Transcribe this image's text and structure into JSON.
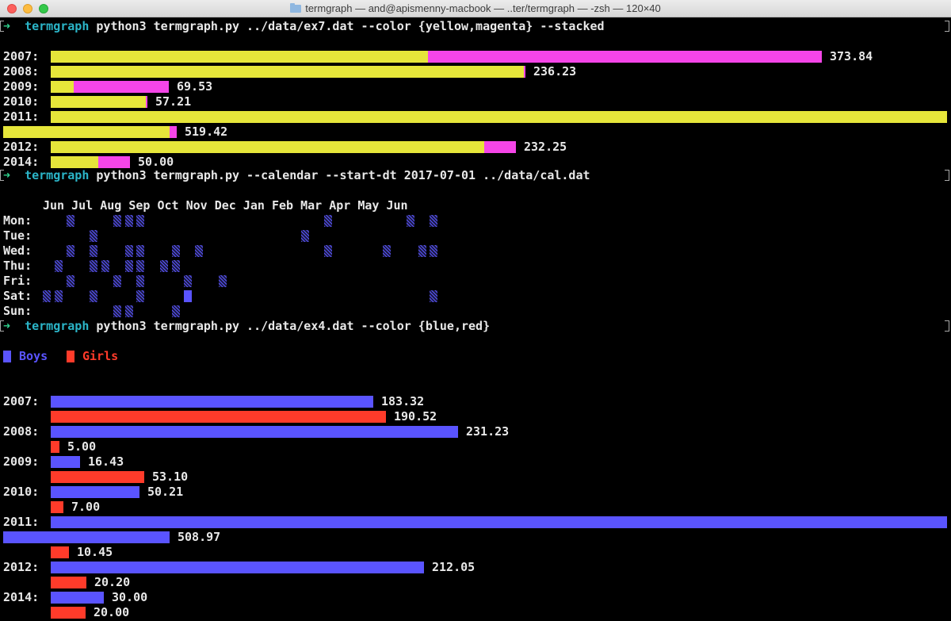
{
  "window": {
    "title": "termgraph — and@apismenny-macbook — ..ter/termgraph — -zsh — 120×40"
  },
  "colors": {
    "yellow": "#e6e63a",
    "magenta": "#f545e8",
    "blue": "#5a54ff",
    "red": "#ff3b2a",
    "prompt_arrow": "#2fd08c",
    "prompt_dir": "#2bb5c8"
  },
  "commands": [
    {
      "arrow": "➜",
      "dir": "termgraph",
      "text": " python3 termgraph.py ../data/ex7.dat --color {yellow,magenta} --stacked"
    },
    {
      "arrow": "➜",
      "dir": "termgraph",
      "text": " python3 termgraph.py --calendar --start-dt 2017-07-01 ../data/cal.dat"
    },
    {
      "arrow": "➜",
      "dir": "termgraph",
      "text": " python3 termgraph.py ../data/ex4.dat --color {blue,red}"
    }
  ],
  "stacked_chart": {
    "rows": [
      {
        "label": "2007:",
        "value": "373.84",
        "segments": [
          0.421,
          0.439
        ]
      },
      {
        "label": "2008:",
        "value": "236.23",
        "segments": [
          0.528,
          0.002
        ]
      },
      {
        "label": "2009:",
        "value": "69.53",
        "segments": [
          0.026,
          0.106
        ]
      },
      {
        "label": "2010:",
        "value": "57.21",
        "segments": [
          0.106,
          0.002
        ]
      },
      {
        "label": "2011:",
        "value": "519.42",
        "segments": [
          1.0,
          0.0
        ],
        "wrapped": true
      },
      {
        "label": "2012:",
        "value": "232.25",
        "segments": [
          0.484,
          0.035
        ]
      },
      {
        "label": "2014:",
        "value": "50.00",
        "segments": [
          0.053,
          0.035
        ]
      }
    ]
  },
  "calendar": {
    "months": [
      "Jun",
      "Jul",
      "Aug",
      "Sep",
      "Oct",
      "Nov",
      "Dec",
      "Jan",
      "Feb",
      "Mar",
      "Apr",
      "May",
      "Jun"
    ],
    "days": [
      "Mon:",
      "Tue:",
      "Wed:",
      "Thu:",
      "Fri:",
      "Sat:",
      "Sun:"
    ]
  },
  "grouped_chart": {
    "legend": [
      {
        "label": "Boys",
        "color": "#5a54ff"
      },
      {
        "label": "Girls",
        "color": "#ff3b2a"
      }
    ],
    "rows": [
      {
        "label": "2007:",
        "boys": 183.32,
        "girls": 190.52,
        "boys_text": "183.32",
        "girls_text": "190.52"
      },
      {
        "label": "2008:",
        "boys": 231.23,
        "girls": 5.0,
        "boys_text": "231.23",
        "girls_text": "5.00"
      },
      {
        "label": "2009:",
        "boys": 16.43,
        "girls": 53.1,
        "boys_text": "16.43",
        "girls_text": "53.10"
      },
      {
        "label": "2010:",
        "boys": 50.21,
        "girls": 7.0,
        "boys_text": "50.21",
        "girls_text": "7.00"
      },
      {
        "label": "2011:",
        "boys": 508.97,
        "girls": 10.45,
        "boys_text": "508.97",
        "girls_text": "10.45"
      },
      {
        "label": "2012:",
        "boys": 212.05,
        "girls": 20.2,
        "boys_text": "212.05",
        "girls_text": "20.20"
      },
      {
        "label": "2014:",
        "boys": 30.0,
        "girls": 20.0,
        "boys_text": "30.00",
        "girls_text": "20.00"
      }
    ]
  }
}
